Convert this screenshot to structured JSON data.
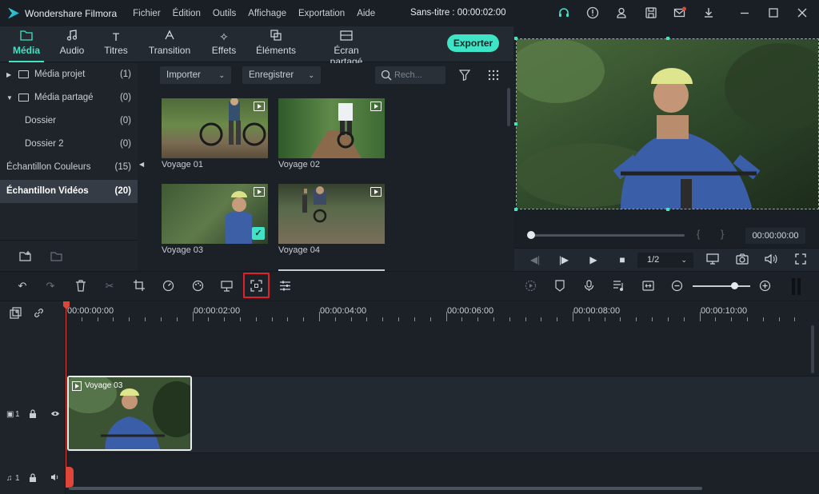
{
  "titlebar": {
    "app_name": "Wondershare Filmora",
    "menu": [
      "Fichier",
      "Édition",
      "Outils",
      "Affichage",
      "Exportation",
      "Aide"
    ],
    "window_title": "Sans-titre : 00:00:02:00"
  },
  "tabs": [
    {
      "label": "Média",
      "active": true
    },
    {
      "label": "Audio"
    },
    {
      "label": "Titres"
    },
    {
      "label": "Transition"
    },
    {
      "label": "Effets"
    },
    {
      "label": "Éléments"
    },
    {
      "label": "Écran partagé"
    }
  ],
  "export_label": "Exporter",
  "sidebar": {
    "items": [
      {
        "label": "Média projet",
        "count": "(1)"
      },
      {
        "label": "Média partagé",
        "count": "(0)"
      },
      {
        "label": "Dossier",
        "count": "(0)"
      },
      {
        "label": "Dossier 2",
        "count": "(0)"
      },
      {
        "label": "Échantillon Couleurs",
        "count": "(15)"
      },
      {
        "label": "Échantillon Vidéos",
        "count": "(20)",
        "selected": true
      }
    ]
  },
  "media": {
    "import_label": "Importer",
    "record_label": "Enregistrer",
    "search_placeholder": "Rech...",
    "items": [
      {
        "label": "Voyage 01"
      },
      {
        "label": "Voyage 02"
      },
      {
        "label": "Voyage 03",
        "checked": true
      },
      {
        "label": "Voyage 04"
      }
    ]
  },
  "preview": {
    "time": "00:00:00:00",
    "ratio": "1/2",
    "progress": 0
  },
  "timeline": {
    "ruler_labels": [
      "00:00:00:00",
      "00:00:02:00",
      "00:00:04:00",
      "00:00:06:00",
      "00:00:08:00",
      "00:00:10:00"
    ],
    "video_track_num": "1",
    "audio_track_num": "1",
    "clip_label": "Voyage 03"
  },
  "colors": {
    "accent": "#3fe3c6",
    "highlight": "#e0202a",
    "playhead": "#e0453a"
  }
}
